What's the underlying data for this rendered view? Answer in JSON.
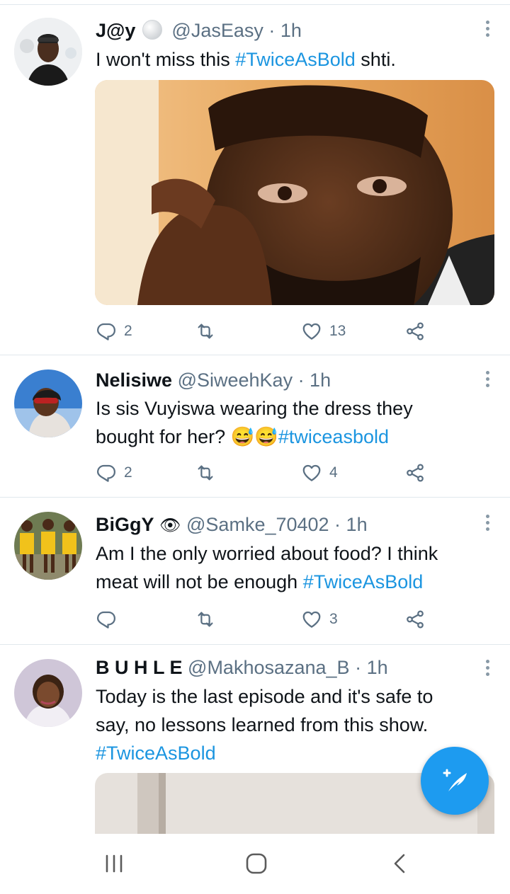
{
  "tweets": [
    {
      "name": "J@y",
      "handle": "@JasEasy · 1h",
      "text_parts": [
        "I won't miss this ",
        "#TwiceAsBold",
        " shti."
      ],
      "replies": "2",
      "retweets": "",
      "likes": "13"
    },
    {
      "name": "Nelisiwe",
      "handle": "@SiweehKay · 1h",
      "line1": "Is sis Vuyiswa wearing the dress they",
      "line2_text": "bought for her? ",
      "line2_emoji": "😅😅",
      "line2_tag": "#twiceasbold",
      "replies": "2",
      "retweets": "",
      "likes": "4"
    },
    {
      "name": "BiGgY",
      "name_emoji": "👁",
      "handle": "@Samke_70402 · 1h",
      "line1": "Am I the only worried about food? I think",
      "line2_text": "meat will not be enough ",
      "line2_tag": "#TwiceAsBold",
      "replies": "",
      "retweets": "",
      "likes": "3"
    },
    {
      "name": "B U H L E",
      "handle": "@Makhosazana_B · 1h",
      "line1": "Today is the last episode and it's safe to",
      "line2": "say, no lessons learned from this show.",
      "line3_tag": "#TwiceAsBold"
    }
  ],
  "icons": {
    "reply": "reply-icon",
    "retweet": "retweet-icon",
    "like": "like-icon",
    "share": "share-icon",
    "more": "more-icon",
    "compose": "compose-tweet-icon",
    "nav_recents": "recents-icon",
    "nav_home": "home-icon",
    "nav_back": "back-icon"
  },
  "colors": {
    "accent": "#1d9bf0",
    "hashtag": "#1b95e0",
    "secondary_text": "#5b7083",
    "divider": "#e1e8ed"
  }
}
